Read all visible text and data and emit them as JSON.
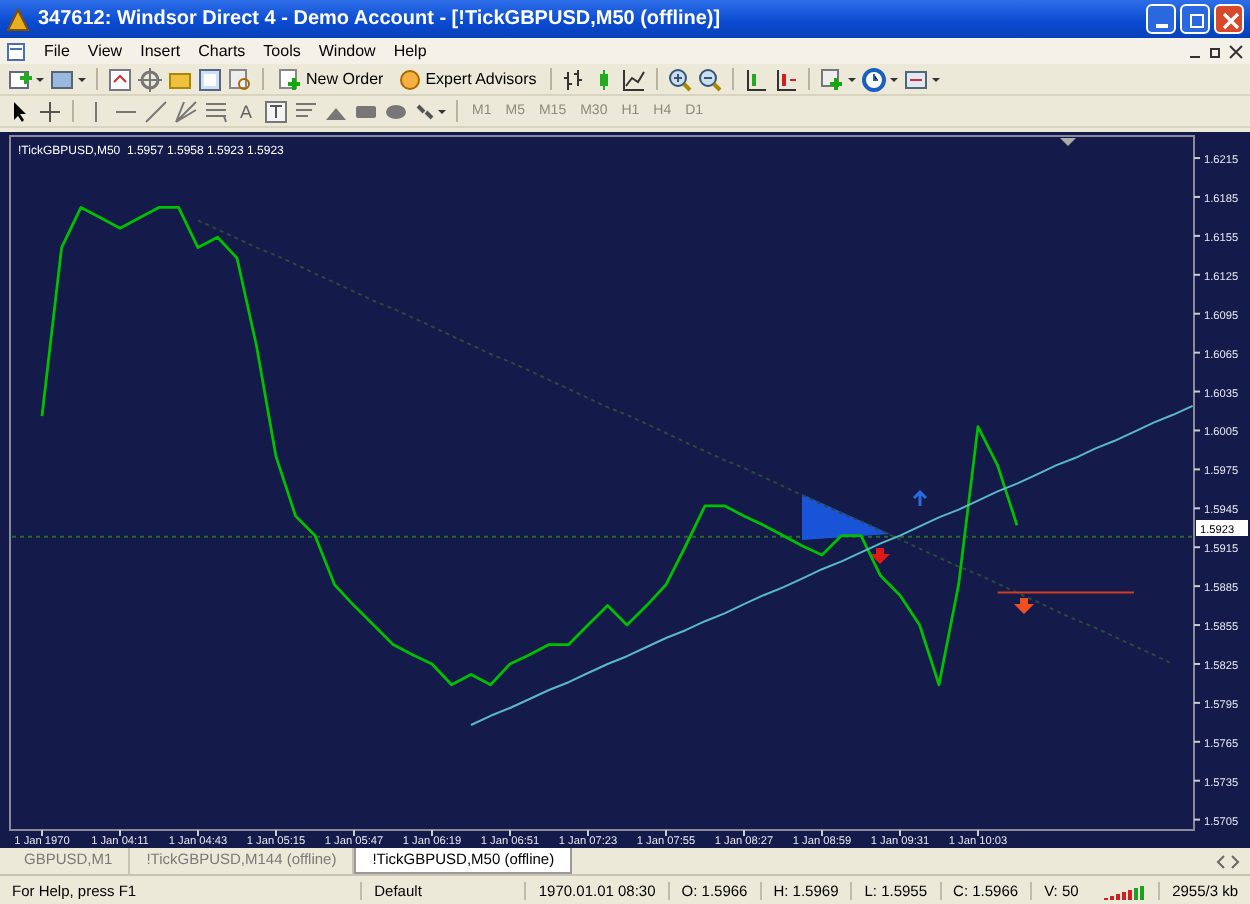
{
  "window": {
    "title": "347612: Windsor Direct 4 - Demo Account - [!TickGBPUSD,M50 (offline)]"
  },
  "menu": [
    "File",
    "View",
    "Insert",
    "Charts",
    "Tools",
    "Window",
    "Help"
  ],
  "toolbar": {
    "buttons": [
      {
        "label": "New Order"
      },
      {
        "label": "Expert Advisors"
      }
    ]
  },
  "drawing_tools": {
    "text_glyph": "A"
  },
  "periods": [
    {
      "label": "M1",
      "disabled": true
    },
    {
      "label": "M5",
      "disabled": true
    },
    {
      "label": "M15",
      "disabled": true
    },
    {
      "label": "M30",
      "disabled": true
    },
    {
      "label": "H1",
      "disabled": true
    },
    {
      "label": "H4",
      "disabled": true
    },
    {
      "label": "D1",
      "disabled": true
    }
  ],
  "chart": {
    "header": "!TickGBPUSD,M50  1.5957 1.5958 1.5923 1.5923",
    "price_tag": "1.5923",
    "chart_data": {
      "type": "line",
      "categories": [
        "1 Jan 1970",
        null,
        null,
        null,
        "1 Jan 04:11",
        null,
        null,
        null,
        "1 Jan 04:43",
        null,
        null,
        null,
        "1 Jan 05:15",
        null,
        null,
        null,
        "1 Jan 05:47",
        null,
        null,
        null,
        "1 Jan 06:19",
        null,
        null,
        null,
        "1 Jan 06:51",
        null,
        null,
        null,
        "1 Jan 07:23",
        null,
        null,
        null,
        "1 Jan 07:55",
        null,
        null,
        null,
        "1 Jan 08:27",
        null,
        null,
        null,
        "1 Jan 08:59",
        null,
        null,
        null,
        "1 Jan 09:31",
        null,
        null,
        null,
        "1 Jan 10:03",
        null,
        null,
        null,
        null,
        null,
        null,
        null,
        null,
        null,
        null,
        null
      ],
      "series": [
        {
          "color": "#00c000",
          "values": [
            1.6016,
            1.6146,
            1.6177,
            1.6169,
            1.6161,
            1.6169,
            1.6177,
            1.6177,
            1.6146,
            1.6154,
            1.6138,
            1.607,
            1.5985,
            1.5939,
            1.5924,
            1.5886,
            1.587,
            1.5855,
            1.584,
            1.5832,
            1.5825,
            1.5809,
            1.5817,
            1.5809,
            1.5825,
            1.5832,
            1.584,
            1.584,
            1.5855,
            1.587,
            1.5855,
            1.587,
            1.5886,
            1.5916,
            1.5947,
            1.5947,
            1.5939,
            1.5932,
            1.5924,
            1.5916,
            1.5909,
            1.5924,
            1.5924,
            1.5893,
            1.5878,
            1.5855,
            1.5809,
            1.5886,
            1.6008,
            1.5978,
            1.5932,
            null,
            null,
            null,
            null,
            null,
            null,
            null,
            null,
            null
          ]
        },
        {
          "color": "#2a4a3a",
          "line_style": "dashed",
          "values": [
            null,
            null,
            null,
            null,
            null,
            null,
            null,
            null,
            1.6167,
            1.616,
            1.6153,
            1.6146,
            1.614,
            1.6133,
            1.6126,
            1.6119,
            1.6112,
            1.6105,
            1.6099,
            1.6092,
            1.6085,
            1.6078,
            1.6071,
            1.6064,
            1.6058,
            1.6051,
            1.6044,
            1.6037,
            1.603,
            1.6023,
            1.6017,
            1.601,
            1.6003,
            1.5996,
            1.5989,
            1.5982,
            1.5976,
            1.5969,
            1.5962,
            1.5955,
            1.5948,
            1.5941,
            1.5935,
            1.5928,
            1.5921,
            1.5914,
            1.5907,
            1.59,
            1.5894,
            1.5887,
            1.588,
            1.5873,
            1.5866,
            1.5859,
            1.5853,
            1.5846,
            1.5839,
            1.5832,
            1.5825,
            null
          ]
        },
        {
          "color": "#5ab8c8",
          "values": [
            null,
            null,
            null,
            null,
            null,
            null,
            null,
            null,
            null,
            null,
            null,
            null,
            null,
            null,
            null,
            null,
            null,
            null,
            null,
            null,
            null,
            null,
            1.5778,
            1.5785,
            1.5791,
            1.5798,
            1.5805,
            1.5811,
            1.5818,
            1.5825,
            1.5831,
            1.5838,
            1.5845,
            1.5851,
            1.5858,
            1.5864,
            1.5871,
            1.5878,
            1.5884,
            1.5891,
            1.5898,
            1.5904,
            1.5911,
            1.5918,
            1.5924,
            1.5931,
            1.5938,
            1.5944,
            1.5951,
            1.5958,
            1.5964,
            1.5971,
            1.5978,
            1.5984,
            1.5991,
            1.5997,
            1.6004,
            1.6011,
            1.6017,
            1.6024
          ]
        },
        {
          "color": "#d04020",
          "values": [
            null,
            null,
            null,
            null,
            null,
            null,
            null,
            null,
            null,
            null,
            null,
            null,
            null,
            null,
            null,
            null,
            null,
            null,
            null,
            null,
            null,
            null,
            null,
            null,
            null,
            null,
            null,
            null,
            null,
            null,
            null,
            null,
            null,
            null,
            null,
            null,
            null,
            null,
            null,
            null,
            null,
            null,
            null,
            null,
            null,
            null,
            null,
            null,
            null,
            1.588,
            1.588,
            1.588,
            1.588,
            1.588,
            1.588,
            1.588,
            1.588,
            null,
            null,
            null
          ]
        }
      ],
      "ref_lines": [
        {
          "axis": "y",
          "value": 1.5923
        }
      ],
      "ylim": [
        1.5697,
        1.6232
      ],
      "yticks": [
        1.6215,
        1.6185,
        1.6155,
        1.6125,
        1.6095,
        1.6065,
        1.6035,
        1.6005,
        1.5975,
        1.5945,
        1.5915,
        1.5885,
        1.5855,
        1.5825,
        1.5795,
        1.5765,
        1.5735,
        1.5705
      ]
    }
  },
  "tabs": [
    {
      "label": "GBPUSD,M1",
      "selected": false
    },
    {
      "label": "!TickGBPUSD,M144 (offline)",
      "selected": false
    },
    {
      "label": "!TickGBPUSD,M50 (offline)",
      "selected": true
    }
  ],
  "status_bar": {
    "help": "For Help, press F1",
    "profile": "Default",
    "time": "1970.01.01 08:30",
    "open": "O: 1.5966",
    "high": "H: 1.5969",
    "low": "L: 1.5955",
    "close": "C: 1.5966",
    "volume": "V: 50",
    "traffic": "2955/3 kb"
  }
}
